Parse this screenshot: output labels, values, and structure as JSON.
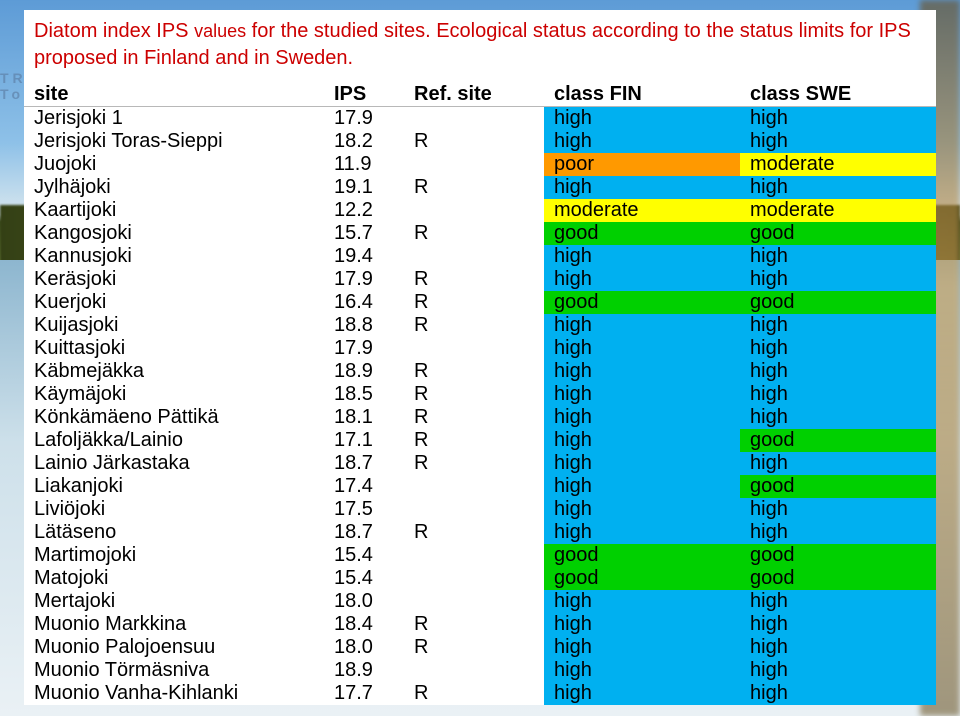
{
  "title_a": "Diatom index IPS ",
  "title_vals": "values",
  "title_b": " for the studied sites. Ecological status according to the status limits for IPS proposed in Finland and in Sweden.",
  "leftstub_line1": "TR",
  "leftstub_line2": "To",
  "headers": {
    "site": "site",
    "ips": "IPS",
    "ref": "Ref. site",
    "fin": "class FIN",
    "swe": "class SWE"
  },
  "class_colors": {
    "high": "c-high",
    "good": "c-good",
    "moderate": "c-moderate",
    "poor": "c-poor"
  },
  "rows": [
    {
      "site": "Jerisjoki 1",
      "ips": "17.9",
      "ref": "",
      "fin": "high",
      "swe": "high"
    },
    {
      "site": "Jerisjoki Toras-Sieppi",
      "ips": "18.2",
      "ref": "R",
      "fin": "high",
      "swe": "high"
    },
    {
      "site": "Juojoki",
      "ips": "11.9",
      "ref": "",
      "fin": "poor",
      "swe": "moderate"
    },
    {
      "site": "Jylhäjoki",
      "ips": "19.1",
      "ref": "R",
      "fin": "high",
      "swe": "high"
    },
    {
      "site": "Kaartijoki",
      "ips": "12.2",
      "ref": "",
      "fin": "moderate",
      "swe": "moderate"
    },
    {
      "site": "Kangosjoki",
      "ips": "15.7",
      "ref": "R",
      "fin": "good",
      "swe": "good"
    },
    {
      "site": "Kannusjoki",
      "ips": "19.4",
      "ref": "",
      "fin": "high",
      "swe": "high"
    },
    {
      "site": "Keräsjoki",
      "ips": "17.9",
      "ref": "R",
      "fin": "high",
      "swe": "high"
    },
    {
      "site": "Kuerjoki",
      "ips": "16.4",
      "ref": "R",
      "fin": "good",
      "swe": "good"
    },
    {
      "site": "Kuijasjoki",
      "ips": "18.8",
      "ref": "R",
      "fin": "high",
      "swe": "high"
    },
    {
      "site": "Kuittasjoki",
      "ips": "17.9",
      "ref": "",
      "fin": "high",
      "swe": "high"
    },
    {
      "site": "Käbmejäkka",
      "ips": "18.9",
      "ref": "R",
      "fin": "high",
      "swe": "high"
    },
    {
      "site": "Käymäjoki",
      "ips": "18.5",
      "ref": "R",
      "fin": "high",
      "swe": "high"
    },
    {
      "site": "Könkämäeno Pättikä",
      "ips": "18.1",
      "ref": "R",
      "fin": "high",
      "swe": "high"
    },
    {
      "site": "Lafoljäkka/Lainio",
      "ips": "17.1",
      "ref": "R",
      "fin": "high",
      "swe": "good"
    },
    {
      "site": "Lainio Järkastaka",
      "ips": "18.7",
      "ref": "R",
      "fin": "high",
      "swe": "high"
    },
    {
      "site": "Liakanjoki",
      "ips": "17.4",
      "ref": "",
      "fin": "high",
      "swe": "good"
    },
    {
      "site": "Liviöjoki",
      "ips": "17.5",
      "ref": "",
      "fin": "high",
      "swe": "high"
    },
    {
      "site": "Lätäseno",
      "ips": "18.7",
      "ref": "R",
      "fin": "high",
      "swe": "high"
    },
    {
      "site": "Martimojoki",
      "ips": "15.4",
      "ref": "",
      "fin": "good",
      "swe": "good"
    },
    {
      "site": "Matojoki",
      "ips": "15.4",
      "ref": "",
      "fin": "good",
      "swe": "good"
    },
    {
      "site": "Mertajoki",
      "ips": "18.0",
      "ref": "",
      "fin": "high",
      "swe": "high"
    },
    {
      "site": "Muonio Markkina",
      "ips": "18.4",
      "ref": "R",
      "fin": "high",
      "swe": "high"
    },
    {
      "site": "Muonio Palojoensuu",
      "ips": "18.0",
      "ref": "R",
      "fin": "high",
      "swe": "high"
    },
    {
      "site": "Muonio Törmäsniva",
      "ips": "18.9",
      "ref": "",
      "fin": "high",
      "swe": "high"
    },
    {
      "site": "Muonio Vanha-Kihlanki",
      "ips": "17.7",
      "ref": "R",
      "fin": "high",
      "swe": "high"
    }
  ]
}
